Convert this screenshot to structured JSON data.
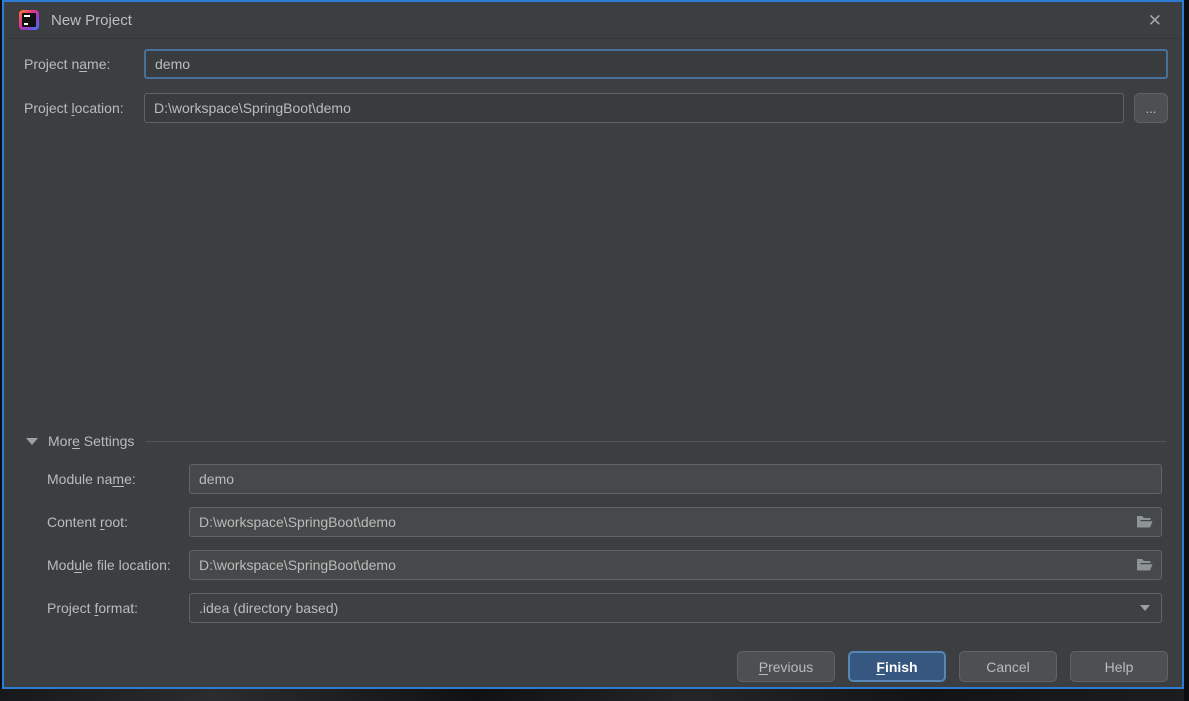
{
  "window": {
    "title": "New Project",
    "close_icon": "✕"
  },
  "form": {
    "project_name": {
      "label_pre": "Project n",
      "label_mn": "a",
      "label_post": "me:",
      "value": "demo"
    },
    "project_location": {
      "label_pre": "Project ",
      "label_mn": "l",
      "label_post": "ocation:",
      "value": "D:\\workspace\\SpringBoot\\demo",
      "browse_label": "..."
    }
  },
  "more_settings": {
    "header_pre": "Mor",
    "header_mn": "e",
    "header_post": " Settings",
    "module_name": {
      "label_pre": "Module na",
      "label_mn": "m",
      "label_post": "e:",
      "value": "demo"
    },
    "content_root": {
      "label_pre": "Content ",
      "label_mn": "r",
      "label_post": "oot:",
      "value": "D:\\workspace\\SpringBoot\\demo"
    },
    "module_file_location": {
      "label_pre": "Mod",
      "label_mn": "u",
      "label_post": "le file location:",
      "value": "D:\\workspace\\SpringBoot\\demo"
    },
    "project_format": {
      "label_pre": "Project ",
      "label_mn": "f",
      "label_post": "ormat:",
      "value": ".idea (directory based)"
    }
  },
  "buttons": {
    "previous": {
      "pre": "",
      "mn": "P",
      "post": "revious"
    },
    "finish": {
      "pre": "",
      "mn": "F",
      "post": "inish"
    },
    "cancel": {
      "pre": "Cancel",
      "mn": "",
      "post": ""
    },
    "help": {
      "pre": "Help",
      "mn": "",
      "post": ""
    }
  },
  "colors": {
    "window_border": "#2e7bd6",
    "dialog_bg": "#3c3f41",
    "focus_border": "#487098",
    "finish_bg": "#365880"
  }
}
